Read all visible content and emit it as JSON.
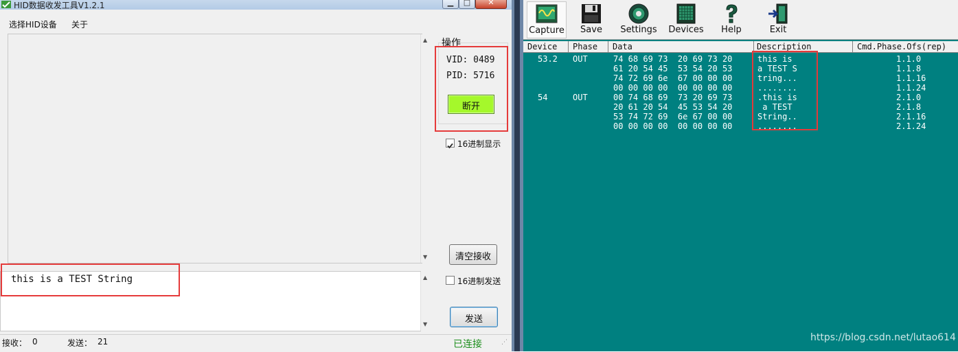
{
  "left_app": {
    "title": "HID数据收发工具V1.2.1",
    "menu": [
      "选择HID设备",
      "关于"
    ],
    "send_text": "this is a TEST String",
    "group_title": "操作",
    "vid_label": "VID: 0489",
    "pid_label": "PID: 5716",
    "disconnect_label": "断开",
    "hex_display_label": "16进制显示",
    "hex_display_checked": true,
    "clear_label": "清空接收",
    "hex_send_label": "16进制发送",
    "hex_send_checked": false,
    "send_label": "发送",
    "status": {
      "recv_label": "接收：",
      "recv_count": "0",
      "send_label": "发送：",
      "send_count": "21",
      "connection": "已连接"
    },
    "colors": {
      "connect_button": "#a5f82b",
      "connection_text": "#1c8e1c",
      "highlight_box": "#e53a3a"
    }
  },
  "right_app": {
    "toolbar": [
      {
        "label": "Capture",
        "icon": "capture-icon"
      },
      {
        "label": "Save",
        "icon": "save-icon"
      },
      {
        "label": "Settings",
        "icon": "settings-icon"
      },
      {
        "label": "Devices",
        "icon": "devices-icon"
      },
      {
        "label": "Help",
        "icon": "help-icon"
      },
      {
        "label": "Exit",
        "icon": "exit-icon"
      }
    ],
    "columns": [
      "Device",
      "Phase",
      "Data",
      "Description",
      "Cmd.Phase.Ofs(rep)"
    ],
    "rows": [
      {
        "device": "53.2",
        "phase": "OUT",
        "data": "74 68 69 73  20 69 73 20",
        "description": "this is ",
        "ofs": "1.1.0"
      },
      {
        "device": "",
        "phase": "",
        "data": "61 20 54 45  53 54 20 53",
        "description": "a TEST S",
        "ofs": "1.1.8"
      },
      {
        "device": "",
        "phase": "",
        "data": "74 72 69 6e  67 00 00 00",
        "description": "tring...",
        "ofs": "1.1.16"
      },
      {
        "device": "",
        "phase": "",
        "data": "00 00 00 00  00 00 00 00",
        "description": "........",
        "ofs": "1.1.24"
      },
      {
        "device": "54",
        "phase": "OUT",
        "data": "00 74 68 69  73 20 69 73",
        "description": ".this is",
        "ofs": "2.1.0"
      },
      {
        "device": "",
        "phase": "",
        "data": "20 61 20 54  45 53 54 20",
        "description": " a TEST ",
        "ofs": "2.1.8"
      },
      {
        "device": "",
        "phase": "",
        "data": "53 74 72 69  6e 67 00 00",
        "description": "String..",
        "ofs": "2.1.16"
      },
      {
        "device": "",
        "phase": "",
        "data": "00 00 00 00  00 00 00 00",
        "description": "........",
        "ofs": "2.1.24"
      }
    ],
    "colors": {
      "background": "#008080",
      "text": "#ffffff"
    }
  },
  "watermark": "https://blog.csdn.net/lutao614"
}
